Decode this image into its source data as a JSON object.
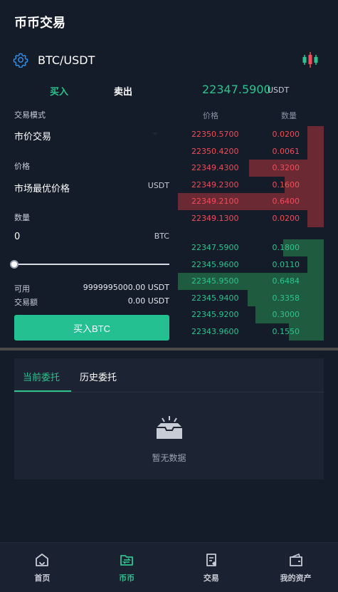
{
  "header": {
    "title": "币币交易"
  },
  "pair": {
    "name": "BTC/USDT"
  },
  "trade_tabs": {
    "buy": "买入",
    "sell": "卖出"
  },
  "ticker": {
    "price": "22347.5900",
    "unit": "USDT"
  },
  "form": {
    "mode_label": "交易模式",
    "mode_value": "市价交易",
    "price_label": "价格",
    "price_value": "市场最优价格",
    "price_unit": "USDT",
    "amount_label": "数量",
    "amount_value": "0",
    "amount_unit": "BTC",
    "slider_fraction": 0,
    "balance_label": "可用",
    "balance_value": "9999995000.00 USDT",
    "total_label": "交易额",
    "total_value": "0.00 USDT",
    "submit_label": "买入BTC"
  },
  "orderbook": {
    "price_header": "价格",
    "qty_header": "数量",
    "asks": [
      {
        "price": "22350.5700",
        "qty": "0.0200",
        "depth": 0.11
      },
      {
        "price": "22350.4200",
        "qty": "0.0061",
        "depth": 0.11
      },
      {
        "price": "22349.4300",
        "qty": "0.3200",
        "depth": 0.51
      },
      {
        "price": "22349.2300",
        "qty": "0.1600",
        "depth": 0.27
      },
      {
        "price": "22349.2100",
        "qty": "0.6400",
        "depth": 1.0
      },
      {
        "price": "22349.1300",
        "qty": "0.0200",
        "depth": 0.11
      }
    ],
    "bids": [
      {
        "price": "22347.5900",
        "qty": "0.1800",
        "depth": 0.28
      },
      {
        "price": "22345.9600",
        "qty": "0.0110",
        "depth": 0.11
      },
      {
        "price": "22345.9500",
        "qty": "0.6484",
        "depth": 1.0
      },
      {
        "price": "22345.9400",
        "qty": "0.3358",
        "depth": 0.52
      },
      {
        "price": "22345.9200",
        "qty": "0.3000",
        "depth": 0.47
      },
      {
        "price": "22343.9600",
        "qty": "0.1550",
        "depth": 0.24
      }
    ]
  },
  "orders": {
    "tab_current": "当前委托",
    "tab_history": "历史委托",
    "empty_text": "暂无数据"
  },
  "nav": [
    {
      "label": "首页",
      "icon": "home-icon",
      "active": false
    },
    {
      "label": "币币",
      "icon": "exchange-icon",
      "active": true
    },
    {
      "label": "交易",
      "icon": "trade-doc-icon",
      "active": false
    },
    {
      "label": "我的资产",
      "icon": "wallet-icon",
      "active": false
    }
  ],
  "colors": {
    "accent": "#2ec28e",
    "ask": "#ef4d5a",
    "background": "#141b29"
  }
}
